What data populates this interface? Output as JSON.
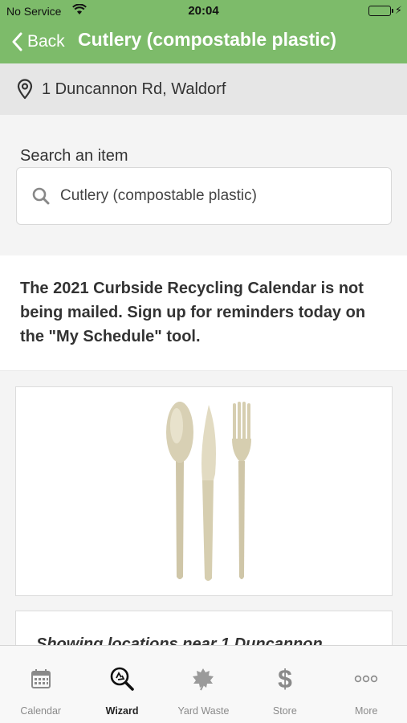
{
  "status_bar": {
    "carrier": "No Service",
    "time": "20:04"
  },
  "nav": {
    "back_label": "Back",
    "title": "Cutlery (compostable plastic)"
  },
  "address": {
    "text": "1 Duncannon Rd, Waldorf"
  },
  "search": {
    "label": "Search an item",
    "value": "Cutlery (compostable plastic)"
  },
  "notice": {
    "text": "The 2021 Curbside Recycling Calendar is not being mailed. Sign up for reminders today on the \"My Schedule\" tool."
  },
  "locations": {
    "heading": "Showing locations near 1 Duncannon"
  },
  "tabbar": {
    "items": [
      {
        "label": "Calendar",
        "icon": "calendar-icon",
        "active": false
      },
      {
        "label": "Wizard",
        "icon": "recycle-search-icon",
        "active": true
      },
      {
        "label": "Yard Waste",
        "icon": "leaf-icon",
        "active": false
      },
      {
        "label": "Store",
        "icon": "dollar-icon",
        "active": false
      },
      {
        "label": "More",
        "icon": "more-dots-icon",
        "active": false
      }
    ]
  },
  "colors": {
    "header_green": "#7dbb6a",
    "address_bg": "#e6e6e6",
    "page_bg": "#f4f4f4"
  }
}
